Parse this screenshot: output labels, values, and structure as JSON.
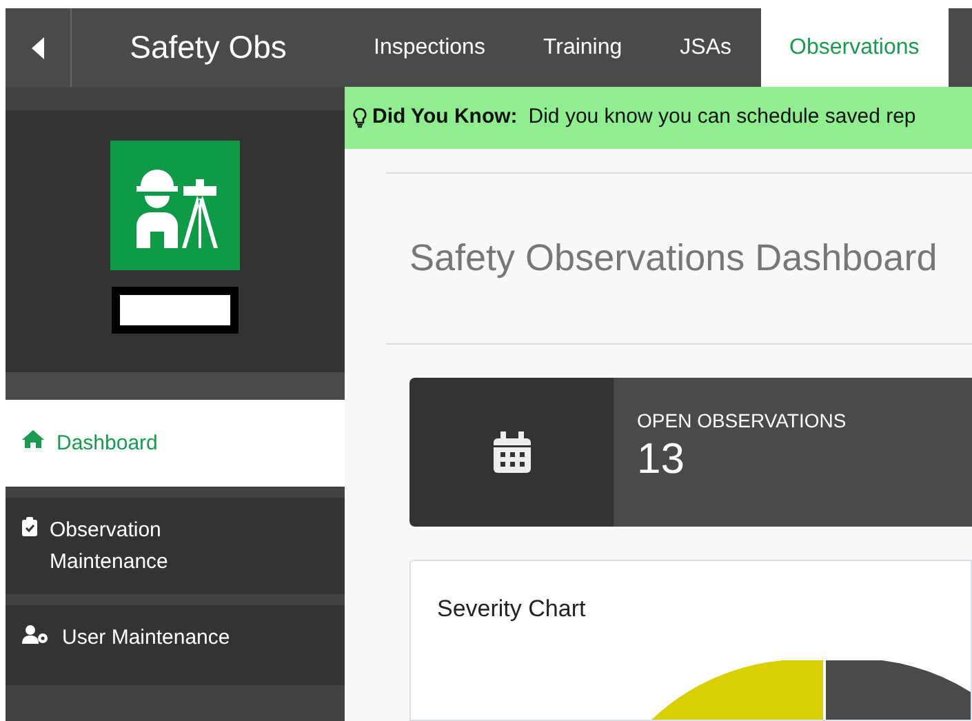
{
  "header": {
    "title": "Safety Obs"
  },
  "tabs": [
    {
      "label": "Inspections",
      "selected": false
    },
    {
      "label": "Training",
      "selected": false
    },
    {
      "label": "JSAs",
      "selected": false
    },
    {
      "label": "Observations",
      "selected": true
    }
  ],
  "sidebar": {
    "items": [
      {
        "label": "Dashboard",
        "kind": "home",
        "selected": true
      },
      {
        "label": "Observation Maintenance",
        "kind": "clipboard",
        "selected": false
      },
      {
        "label": "User Maintenance",
        "kind": "users",
        "selected": false
      }
    ]
  },
  "tip": {
    "label": "Did You Know:",
    "text": "Did you know you can schedule saved rep"
  },
  "page_title": "Safety Observations Dashboard",
  "stat": {
    "label": "OPEN OBSERVATIONS",
    "value": "13"
  },
  "chart": {
    "title": "Severity Chart"
  }
}
